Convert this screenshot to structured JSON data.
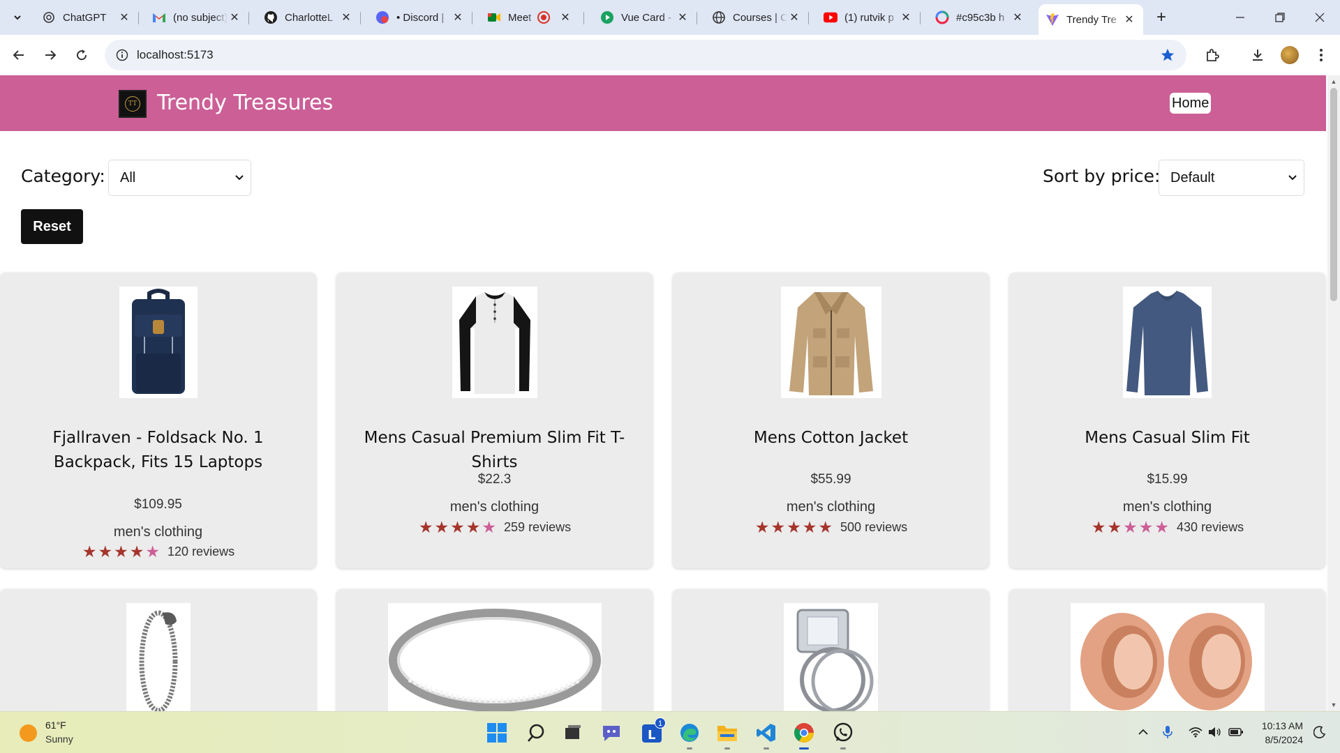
{
  "browser": {
    "tabs": [
      {
        "title": "ChatGPT",
        "icon": "chatgpt-icon"
      },
      {
        "title": "(no subject)",
        "icon": "gmail-icon"
      },
      {
        "title": "CharlotteL",
        "icon": "github-icon"
      },
      {
        "title": "• Discord |",
        "icon": "discord-icon"
      },
      {
        "title": "Meet -",
        "icon": "meet-icon"
      },
      {
        "title": "Vue Card -",
        "icon": "vue-card-icon"
      },
      {
        "title": "Courses | C",
        "icon": "globe-icon"
      },
      {
        "title": "(1) rutvik p",
        "icon": "youtube-icon"
      },
      {
        "title": "#c95c3b h",
        "icon": "color-icon"
      },
      {
        "title": "Trendy Tre",
        "icon": "vite-icon",
        "active": true
      }
    ],
    "url": "localhost:5173"
  },
  "site": {
    "brand": "Trendy Treasures",
    "logo_text": "TT",
    "nav": {
      "home": "Home"
    },
    "header_color": "#cb5f96"
  },
  "filters": {
    "category_label": "Category:",
    "category_value": "All",
    "sort_label": "Sort by price:",
    "sort_value": "Default",
    "reset_label": "Reset"
  },
  "products": [
    {
      "name": "Fjallraven - Foldsack No. 1 Backpack, Fits 15 Laptops",
      "price": "$109.95",
      "category": "men's clothing",
      "rating_stars": 4,
      "reviews": "120 reviews",
      "image": "backpack"
    },
    {
      "name": "Mens Casual Premium Slim Fit T-Shirts",
      "price": "$22.3",
      "category": "men's clothing",
      "rating_stars": 4,
      "reviews": "259 reviews",
      "image": "tshirt"
    },
    {
      "name": "Mens Cotton Jacket",
      "price": "$55.99",
      "category": "men's clothing",
      "rating_stars": 5,
      "reviews": "500 reviews",
      "image": "jacket"
    },
    {
      "name": "Mens Casual Slim Fit",
      "price": "$15.99",
      "category": "men's clothing",
      "rating_stars": 2,
      "reviews": "430 reviews",
      "image": "longsleeve"
    },
    {
      "image": "bracelet"
    },
    {
      "image": "ring"
    },
    {
      "image": "diamond-ring"
    },
    {
      "image": "plugs"
    }
  ],
  "taskbar": {
    "weather_temp": "61°F",
    "weather_cond": "Sunny",
    "time": "10:13 AM",
    "date": "8/5/2024",
    "badge": "1"
  }
}
